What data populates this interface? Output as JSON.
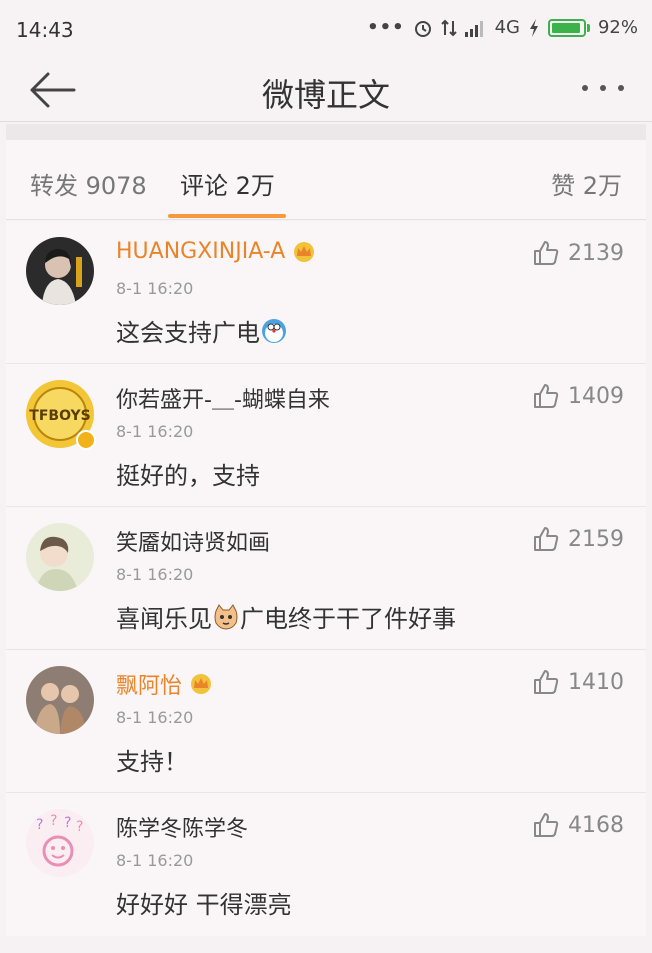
{
  "status_bar": {
    "time": "14:43",
    "network": "4G",
    "battery": "92%",
    "battery_level": 0.92
  },
  "nav": {
    "title": "微博正文"
  },
  "tabs": {
    "repost": "转发 9078",
    "comment": "评论 2万",
    "like": "赞 2万"
  },
  "comments": [
    {
      "name": "HUANGXINJIA-A",
      "vip": true,
      "time": "8-1 16:20",
      "text": "这会支持广电",
      "emoji": "doraemon",
      "likes": "2139"
    },
    {
      "name": "你若盛开-＿-蝴蝶自来",
      "vip": false,
      "verified": true,
      "time": "8-1 16:20",
      "text": "挺好的，支持",
      "likes": "1409"
    },
    {
      "name": "笑靥如诗贤如画",
      "vip": false,
      "time": "8-1 16:20",
      "text_before": "喜闻乐见",
      "text_after": "广电终于干了件好事",
      "emoji": "cat",
      "likes": "2159"
    },
    {
      "name": "飘阿怡",
      "vip": true,
      "time": "8-1 16:20",
      "text": "支持！",
      "likes": "1410"
    },
    {
      "name": "陈学冬陈学冬",
      "vip": false,
      "time": "8-1 16:20",
      "text": "好好好 干得漂亮",
      "likes": "4168"
    }
  ],
  "colors": {
    "accent": "#f49a3c",
    "vip_name": "#e8852a",
    "battery": "#3cb24a"
  }
}
